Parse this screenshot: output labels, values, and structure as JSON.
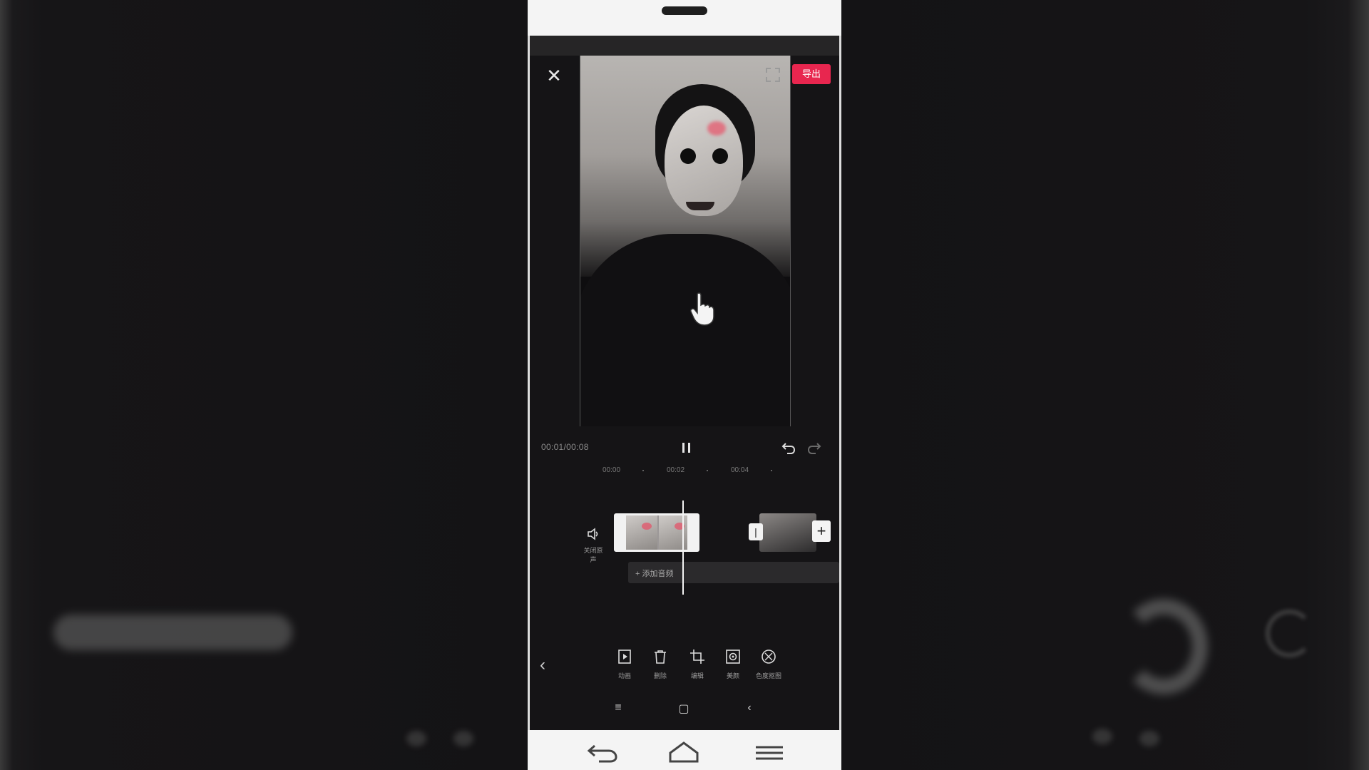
{
  "editor": {
    "export_label": "导出",
    "timecode": "00:01/00:08",
    "ruler_ticks": [
      "00:00",
      "00:02",
      "00:04"
    ],
    "mute_label": "关闭原声",
    "add_audio_label": "+ 添加音频",
    "transition_label": "|",
    "add_clip_symbol": "+"
  },
  "toolbar": {
    "items": [
      {
        "label": "动画",
        "icon": "play-box-icon"
      },
      {
        "label": "删除",
        "icon": "trash-icon"
      },
      {
        "label": "编辑",
        "icon": "crop-icon"
      },
      {
        "label": "美颜",
        "icon": "beauty-icon"
      },
      {
        "label": "色度抠图",
        "icon": "chroma-key-icon"
      }
    ]
  },
  "colors": {
    "accent": "#e8264f",
    "background": "#151416",
    "phone_frame": "#f4f4f4"
  }
}
